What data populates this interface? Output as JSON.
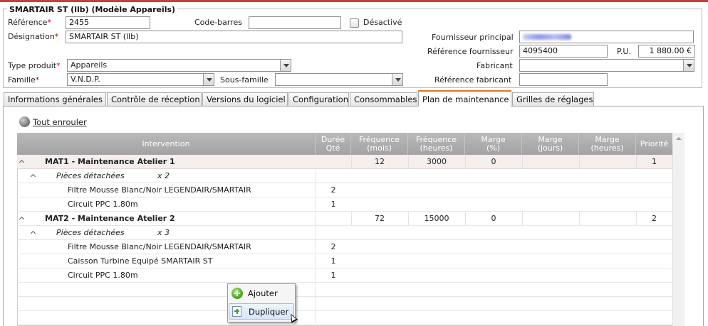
{
  "header": {
    "title": "SMARTAIR ST (llb) (Modèle Appareils)",
    "reference": {
      "label": "Référence",
      "value": "2455"
    },
    "barcode": {
      "label": "Code-barres",
      "value": ""
    },
    "disabled": {
      "label": "Désactivé",
      "checked": false
    },
    "designation": {
      "label": "Désignation",
      "value": "SMARTAIR ST (llb)"
    },
    "product_type": {
      "label": "Type produit",
      "value": "Appareils"
    },
    "family": {
      "label": "Famille",
      "value": "V.N.D.P."
    },
    "subfamily": {
      "label": "Sous-famille",
      "value": ""
    },
    "main_supplier": {
      "label": "Fournisseur principal",
      "value": ""
    },
    "supplier_ref": {
      "label": "Référence fournisseur",
      "value": "4095400"
    },
    "pu": {
      "label": "P.U.",
      "value": "1 880.00 €"
    },
    "manufacturer": {
      "label": "Fabricant",
      "value": ""
    },
    "manufacturer_ref": {
      "label": "Référence fabricant",
      "value": ""
    },
    "required_marker": "*"
  },
  "tabs": [
    {
      "label": "Informations générales",
      "active": false
    },
    {
      "label": "Contrôle de réception",
      "active": false
    },
    {
      "label": "Versions du logiciel",
      "active": false
    },
    {
      "label": "Configuration",
      "active": false
    },
    {
      "label": "Consommables",
      "active": false
    },
    {
      "label": "Plan de maintenance",
      "active": true
    },
    {
      "label": "Grilles de réglages",
      "active": false
    }
  ],
  "toolbar": {
    "collapse_all": "Tout enrouler"
  },
  "grid": {
    "columns": {
      "intervention": "Intervention",
      "duration": [
        "Durée",
        "Qté"
      ],
      "freq_months": [
        "Fréquence",
        "(mois)"
      ],
      "freq_hours": [
        "Fréquence",
        "(heures)"
      ],
      "margin_pct": [
        "Marge",
        "(%)"
      ],
      "margin_days": [
        "Marge",
        "(jours)"
      ],
      "margin_hours": [
        "Marge",
        "(heures)"
      ],
      "priority": "Priorité"
    },
    "groups": [
      {
        "name": "MAT1 - Maintenance Atelier 1",
        "freq_months": "12",
        "freq_hours": "3000",
        "margin_pct": "0",
        "priority": "1",
        "parts_label": "Pièces détachées",
        "parts_count": "x 2",
        "parts": [
          {
            "name": "Filtre Mousse Blanc/Noir  LEGENDAIR/SMARTAIR",
            "qty": "2"
          },
          {
            "name": "Circuit PPC 1.80m",
            "qty": "1"
          }
        ]
      },
      {
        "name": "MAT2 - Maintenance Atelier 2",
        "freq_months": "72",
        "freq_hours": "15000",
        "margin_pct": "0",
        "priority": "2",
        "parts_label": "Pièces détachées",
        "parts_count": "x 3",
        "parts": [
          {
            "name": "Filtre Mousse Blanc/Noir  LEGENDAIR/SMARTAIR",
            "qty": "2"
          },
          {
            "name": "Caisson Turbine Equipé SMARTAIR ST",
            "qty": "1"
          },
          {
            "name": "Circuit PPC 1.80m",
            "qty": "1"
          }
        ]
      }
    ]
  },
  "context_menu": {
    "add": "Ajouter",
    "duplicate": "Dupliquer"
  },
  "colors": {
    "accent": "#e0741e",
    "required": "#cc0000",
    "header_bg": "#a9a9a9",
    "group_row": "#f4eeec"
  }
}
